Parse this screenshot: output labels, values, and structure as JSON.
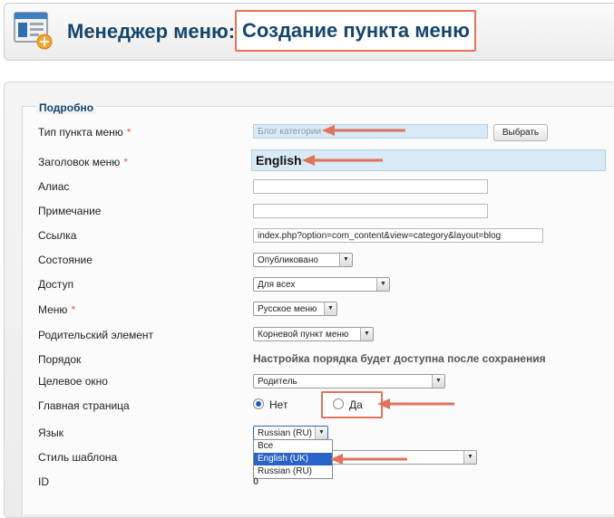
{
  "header": {
    "title_main": "Менеджер меню:",
    "title_sub": "Создание пункта меню",
    "icon": "menu-manager-icon"
  },
  "fieldset": {
    "legend": "Подробно"
  },
  "form": {
    "menu_item_type": {
      "label": "Тип пункта меню",
      "value": "Блог категории",
      "button": "Выбрать"
    },
    "menu_title": {
      "label": "Заголовок меню",
      "value": "English"
    },
    "alias": {
      "label": "Алиас",
      "value": ""
    },
    "note": {
      "label": "Примечание",
      "value": ""
    },
    "link": {
      "label": "Ссылка",
      "value": "index.php?option=com_content&view=category&layout=blog"
    },
    "status": {
      "label": "Состояние",
      "value": "Опубликовано"
    },
    "access": {
      "label": "Доступ",
      "value": "Для всех"
    },
    "menu": {
      "label": "Меню",
      "value": "Русское меню"
    },
    "parent": {
      "label": "Родительский элемент",
      "value": "Корневой пункт меню"
    },
    "ordering": {
      "label": "Порядок",
      "value": "Настройка порядка будет доступна после сохранения"
    },
    "target_window": {
      "label": "Целевое окно",
      "value": "Родитель"
    },
    "home": {
      "label": "Главная страница",
      "option_no": "Нет",
      "option_yes": "Да",
      "selected": "Нет"
    },
    "language": {
      "label": "Язык",
      "value": "Russian (RU)",
      "options": [
        "Все",
        "English (UK)",
        "Russian (RU)"
      ],
      "highlighted": "English (UK)"
    },
    "template_style": {
      "label": "Стиль шаблона",
      "value": ""
    },
    "id": {
      "label": "ID",
      "value": "0"
    },
    "required_mark": "*"
  },
  "colors": {
    "title": "#14466e",
    "highlight_border": "#e0735b",
    "arrow": "#e0735b",
    "required": "#e0662e",
    "readonly_field": "#d9eaf7",
    "dropdown_selected": "#2a63c8"
  }
}
